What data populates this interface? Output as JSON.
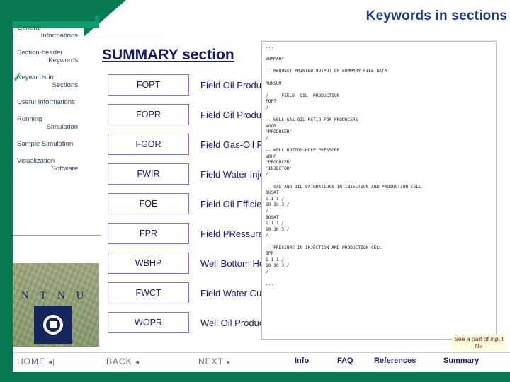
{
  "slide": {
    "title": "Keywords in sections",
    "section_heading": "SUMMARY section",
    "callout": "See a part of input file"
  },
  "sidebar": {
    "items": [
      {
        "line1": "General",
        "line2": "Informations",
        "active": false
      },
      {
        "line1": "Section-header",
        "line2": "Keywords",
        "active": false
      },
      {
        "line1": "Keywords in",
        "line2": "Sections",
        "active": true
      },
      {
        "line1": "Useful Informations",
        "line2": "",
        "active": false
      },
      {
        "line1": "Running",
        "line2": "Simulation",
        "active": false
      },
      {
        "line1": "Sample Simulation",
        "line2": "",
        "active": false
      },
      {
        "line1": "Visualization",
        "line2": "Software",
        "active": false
      }
    ],
    "logo_text": "N T N U"
  },
  "keywords": [
    {
      "code": "FOPT",
      "desc": "Field Oil Production Total"
    },
    {
      "code": "FOPR",
      "desc": "Field Oil Production Rate"
    },
    {
      "code": "FGOR",
      "desc": "Field Gas-Oil Ratio"
    },
    {
      "code": "FWIR",
      "desc": "Field Water Injection Rate"
    },
    {
      "code": "FOE",
      "desc": "Field Oil Efficiency"
    },
    {
      "code": "FPR",
      "desc": "Field PRessure"
    },
    {
      "code": "WBHP",
      "desc": "Well Bottom Hole Pressure"
    },
    {
      "code": "FWCT",
      "desc": "Field Water CuT"
    },
    {
      "code": "WOPR",
      "desc": "Well Oil Production Rate"
    }
  ],
  "code_snippet": "...\n\nSUMMARY\n\n-- REQUEST PRINTED OUTPUT OF SUMMARY FILE DATA\n\nRUNSUM\n\n/     FIELD  OIL  PRODUCTION\nFOPT\n/\n\n-- WELL GAS-OIL RATIO FOR PRODUCERS\nWGOR\n'PRODUCER'\n/\n\n-- WELL BOTTOM-HOLE PRESSURE\nWBHP\n'PRODUCER'\n'INJECTOR'\n/\n\n-- GAS AND OIL SATURATIONS IN INJECTION AND PRODUCTION CELL\nBGSAT\n1 1 1 /\n10 10 3 /\n/\nBOSAT\n1 1 1 /\n10 10 3 /\n/\n\n-- PRESSURE IN INJECTION AND PRODUCTION CELL\nBPR\n1 1 1 /\n10 10 3 /\n/\n\n...",
  "navbar": {
    "home": "HOME",
    "home_icon": "prev-triangle-icon",
    "back": "BACK",
    "next": "NEXT",
    "info": "Info",
    "faq": "FAQ",
    "references": "References",
    "summary": "Summary"
  },
  "colors": {
    "green": "#087a52",
    "navy": "#1a1a6b",
    "title_blue": "#1a3a8f",
    "box_border": "#8b6fae",
    "check_green": "#22b14c"
  }
}
